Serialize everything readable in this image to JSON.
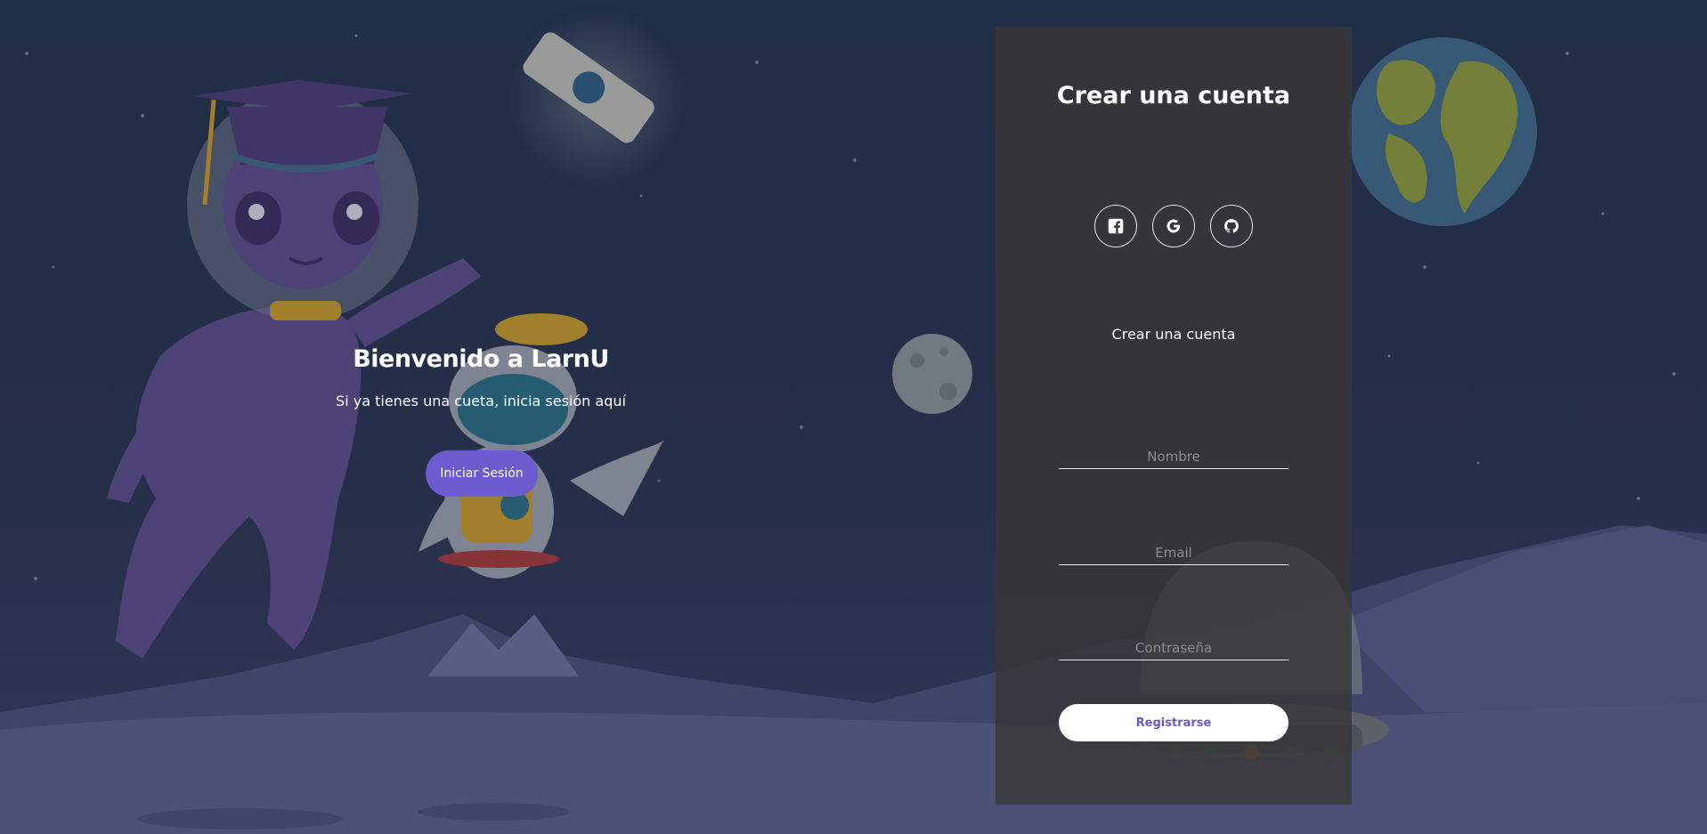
{
  "welcome": {
    "title": "Bienvenido a LarnU",
    "subtitle": "Si ya tienes una cueta, inicia sesión aquí",
    "login_label": "Iniciar Sesión"
  },
  "form": {
    "title": "Crear una cuenta",
    "social": [
      {
        "name": "facebook-icon"
      },
      {
        "name": "google-icon"
      },
      {
        "name": "github-icon"
      }
    ],
    "caption": "Crear una cuenta",
    "name_placeholder": "Nombre",
    "email_placeholder": "Email",
    "password_placeholder": "Contraseña",
    "register_label": "Registrarse"
  },
  "colors": {
    "accent": "#6d5bd0",
    "panel": "#373737",
    "sky": "#28344a",
    "ground": "#5a5c86"
  }
}
